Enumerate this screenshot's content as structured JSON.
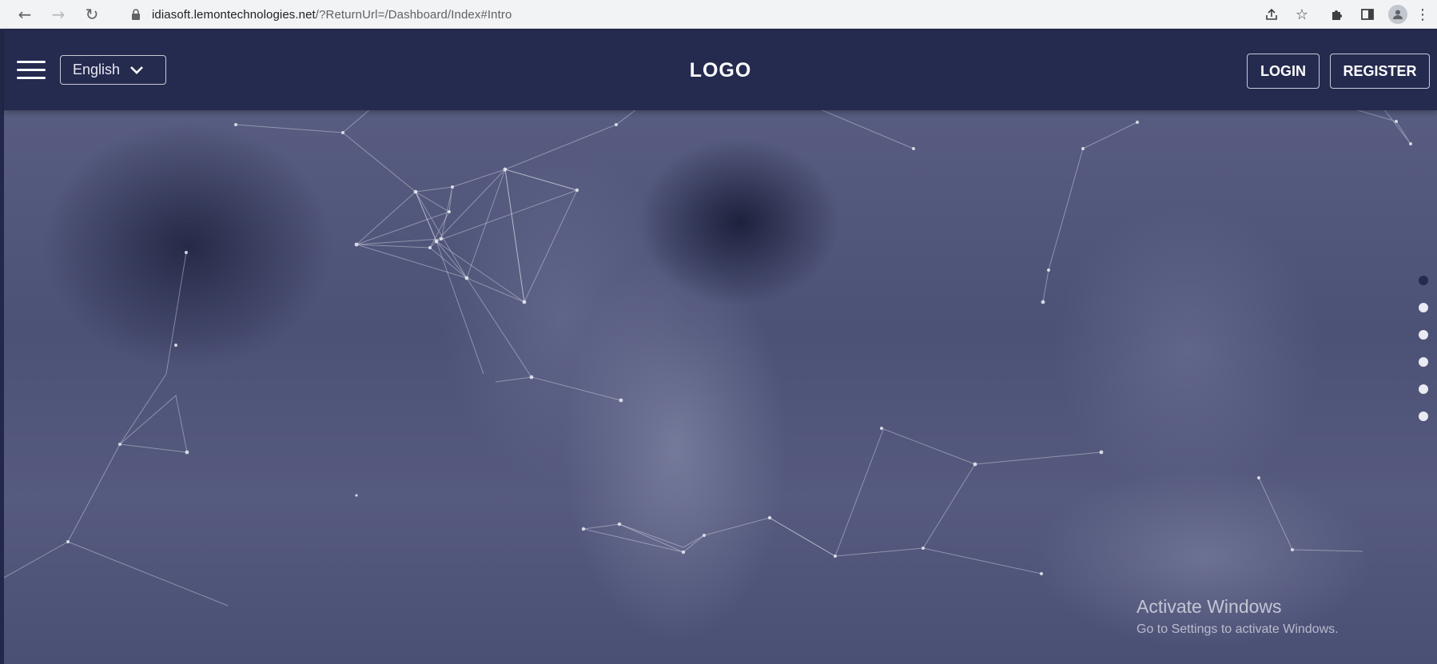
{
  "browser": {
    "url_host": "idiasoft.lemontechnologies.net",
    "url_path": "/?ReturnUrl=/Dashboard/Index#Intro"
  },
  "header": {
    "language": "English",
    "logo": "LOGO",
    "login_label": "LOGIN",
    "register_label": "REGISTER",
    "background_color": "#252a4f"
  },
  "hero": {
    "slide_count": 6,
    "active_slide": 1
  },
  "watermark": {
    "title": "Activate Windows",
    "subtitle": "Go to Settings to activate Windows."
  }
}
